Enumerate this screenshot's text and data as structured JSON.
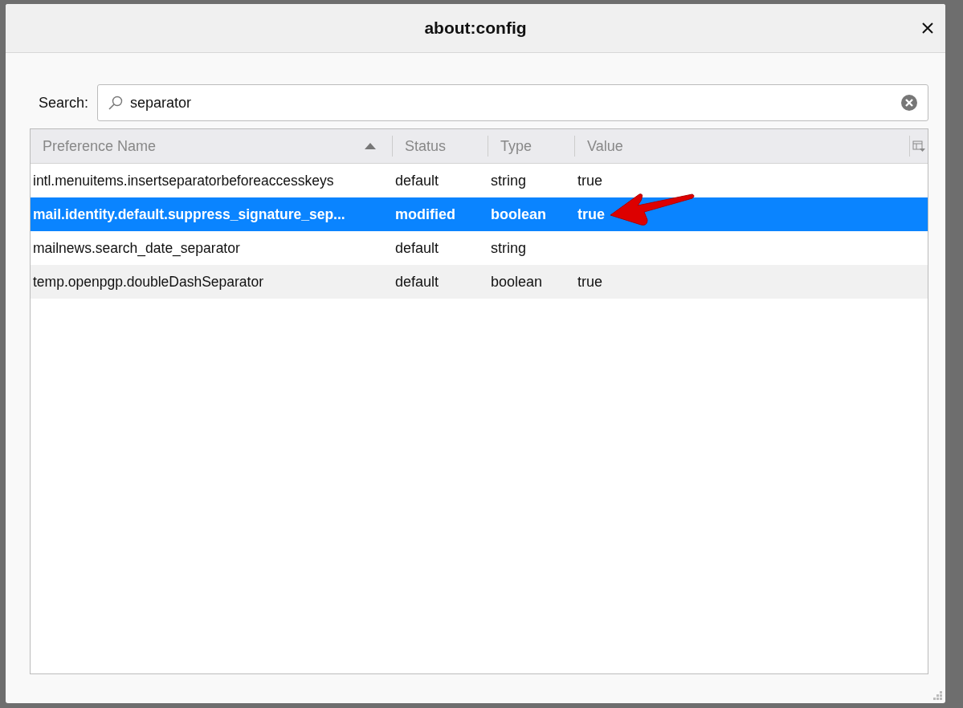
{
  "window": {
    "title": "about:config"
  },
  "search": {
    "label": "Search:",
    "value": "separator"
  },
  "table": {
    "columns": [
      {
        "label": "Preference Name",
        "sorted": true
      },
      {
        "label": "Status",
        "sorted": false
      },
      {
        "label": "Type",
        "sorted": false
      },
      {
        "label": "Value",
        "sorted": false
      }
    ],
    "rows": [
      {
        "name": "intl.menuitems.insertseparatorbeforeaccesskeys",
        "status": "default",
        "type": "string",
        "value": "true",
        "modified": false,
        "selected": false
      },
      {
        "name": "mail.identity.default.suppress_signature_sep...",
        "status": "modified",
        "type": "boolean",
        "value": "true",
        "modified": true,
        "selected": true
      },
      {
        "name": "mailnews.search_date_separator",
        "status": "default",
        "type": "string",
        "modified": false,
        "selected": false
      },
      {
        "name": "temp.openpgp.doubleDashSeparator",
        "status": "default",
        "type": "boolean",
        "value": "true",
        "modified": false,
        "selected": false
      }
    ]
  }
}
